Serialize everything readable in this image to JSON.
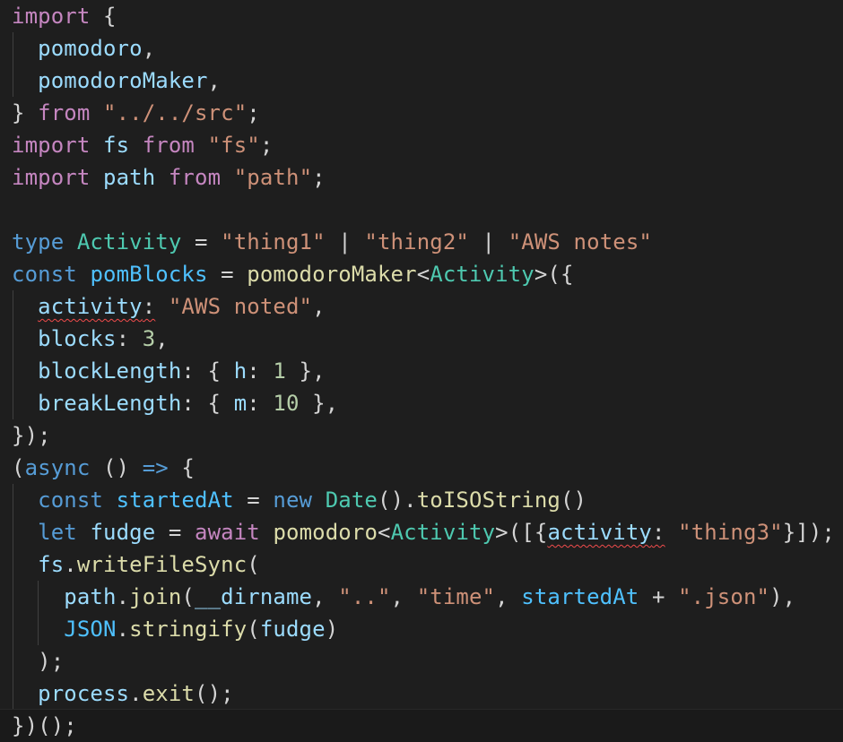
{
  "editor": {
    "lines": [
      [
        {
          "t": "import",
          "c": "kw"
        },
        {
          "t": " {",
          "c": "pun"
        }
      ],
      [
        {
          "t": "  "
        },
        {
          "t": "pomodoro",
          "c": "var"
        },
        {
          "t": ",",
          "c": "pun"
        }
      ],
      [
        {
          "t": "  "
        },
        {
          "t": "pomodoroMaker",
          "c": "var"
        },
        {
          "t": ",",
          "c": "pun"
        }
      ],
      [
        {
          "t": "} ",
          "c": "pun"
        },
        {
          "t": "from",
          "c": "kw"
        },
        {
          "t": " "
        },
        {
          "t": "\"../../src\"",
          "c": "str"
        },
        {
          "t": ";",
          "c": "pun"
        }
      ],
      [
        {
          "t": "import",
          "c": "kw"
        },
        {
          "t": " "
        },
        {
          "t": "fs",
          "c": "var"
        },
        {
          "t": " "
        },
        {
          "t": "from",
          "c": "kw"
        },
        {
          "t": " "
        },
        {
          "t": "\"fs\"",
          "c": "str"
        },
        {
          "t": ";",
          "c": "pun"
        }
      ],
      [
        {
          "t": "import",
          "c": "kw"
        },
        {
          "t": " "
        },
        {
          "t": "path",
          "c": "var"
        },
        {
          "t": " "
        },
        {
          "t": "from",
          "c": "kw"
        },
        {
          "t": " "
        },
        {
          "t": "\"path\"",
          "c": "str"
        },
        {
          "t": ";",
          "c": "pun"
        }
      ],
      [],
      [
        {
          "t": "type",
          "c": "kb"
        },
        {
          "t": " "
        },
        {
          "t": "Activity",
          "c": "type"
        },
        {
          "t": " = ",
          "c": "pun"
        },
        {
          "t": "\"thing1\"",
          "c": "str"
        },
        {
          "t": " | ",
          "c": "pun"
        },
        {
          "t": "\"thing2\"",
          "c": "str"
        },
        {
          "t": " | ",
          "c": "pun"
        },
        {
          "t": "\"AWS notes\"",
          "c": "str"
        }
      ],
      [
        {
          "t": "const",
          "c": "kb"
        },
        {
          "t": " "
        },
        {
          "t": "pomBlocks",
          "c": "const"
        },
        {
          "t": " = ",
          "c": "pun"
        },
        {
          "t": "pomodoroMaker",
          "c": "fn"
        },
        {
          "t": "<",
          "c": "pun"
        },
        {
          "t": "Activity",
          "c": "type"
        },
        {
          "t": ">({",
          "c": "pun"
        }
      ],
      [
        {
          "t": "  "
        },
        {
          "t": "activity",
          "c": "var",
          "err": true
        },
        {
          "t": ":",
          "c": "pun",
          "err": true
        },
        {
          "t": " "
        },
        {
          "t": "\"AWS noted\"",
          "c": "str"
        },
        {
          "t": ",",
          "c": "pun"
        }
      ],
      [
        {
          "t": "  "
        },
        {
          "t": "blocks",
          "c": "var"
        },
        {
          "t": ": ",
          "c": "pun"
        },
        {
          "t": "3",
          "c": "num"
        },
        {
          "t": ",",
          "c": "pun"
        }
      ],
      [
        {
          "t": "  "
        },
        {
          "t": "blockLength",
          "c": "var"
        },
        {
          "t": ": { ",
          "c": "pun"
        },
        {
          "t": "h",
          "c": "var"
        },
        {
          "t": ": ",
          "c": "pun"
        },
        {
          "t": "1",
          "c": "num"
        },
        {
          "t": " },",
          "c": "pun"
        }
      ],
      [
        {
          "t": "  "
        },
        {
          "t": "breakLength",
          "c": "var"
        },
        {
          "t": ": { ",
          "c": "pun"
        },
        {
          "t": "m",
          "c": "var"
        },
        {
          "t": ": ",
          "c": "pun"
        },
        {
          "t": "10",
          "c": "num"
        },
        {
          "t": " },",
          "c": "pun"
        }
      ],
      [
        {
          "t": "});",
          "c": "pun"
        }
      ],
      [
        {
          "t": "(",
          "c": "pun"
        },
        {
          "t": "async",
          "c": "kb"
        },
        {
          "t": " () ",
          "c": "pun"
        },
        {
          "t": "=>",
          "c": "kb"
        },
        {
          "t": " {",
          "c": "pun"
        }
      ],
      [
        {
          "t": "  "
        },
        {
          "t": "const",
          "c": "kb"
        },
        {
          "t": " "
        },
        {
          "t": "startedAt",
          "c": "const"
        },
        {
          "t": " = ",
          "c": "pun"
        },
        {
          "t": "new",
          "c": "kb"
        },
        {
          "t": " "
        },
        {
          "t": "Date",
          "c": "type"
        },
        {
          "t": "().",
          "c": "pun"
        },
        {
          "t": "toISOString",
          "c": "fn"
        },
        {
          "t": "()",
          "c": "pun"
        }
      ],
      [
        {
          "t": "  "
        },
        {
          "t": "let",
          "c": "kb"
        },
        {
          "t": " "
        },
        {
          "t": "fudge",
          "c": "var"
        },
        {
          "t": " = ",
          "c": "pun"
        },
        {
          "t": "await",
          "c": "kw"
        },
        {
          "t": " "
        },
        {
          "t": "pomodoro",
          "c": "fn"
        },
        {
          "t": "<",
          "c": "pun"
        },
        {
          "t": "Activity",
          "c": "type"
        },
        {
          "t": ">([{",
          "c": "pun"
        },
        {
          "t": "activity",
          "c": "var",
          "err": true
        },
        {
          "t": ":",
          "c": "pun",
          "err": true
        },
        {
          "t": " "
        },
        {
          "t": "\"thing3\"",
          "c": "str"
        },
        {
          "t": "}]);",
          "c": "pun"
        }
      ],
      [
        {
          "t": "  "
        },
        {
          "t": "fs",
          "c": "var"
        },
        {
          "t": ".",
          "c": "pun"
        },
        {
          "t": "writeFileSync",
          "c": "fn"
        },
        {
          "t": "(",
          "c": "pun"
        }
      ],
      [
        {
          "t": "    "
        },
        {
          "t": "path",
          "c": "var"
        },
        {
          "t": ".",
          "c": "pun"
        },
        {
          "t": "join",
          "c": "fn"
        },
        {
          "t": "(",
          "c": "pun"
        },
        {
          "t": "__dirname",
          "c": "var"
        },
        {
          "t": ", ",
          "c": "pun"
        },
        {
          "t": "\"..\"",
          "c": "str"
        },
        {
          "t": ", ",
          "c": "pun"
        },
        {
          "t": "\"time\"",
          "c": "str"
        },
        {
          "t": ", ",
          "c": "pun"
        },
        {
          "t": "startedAt",
          "c": "const"
        },
        {
          "t": " + ",
          "c": "pun"
        },
        {
          "t": "\".json\"",
          "c": "str"
        },
        {
          "t": "),",
          "c": "pun"
        }
      ],
      [
        {
          "t": "    "
        },
        {
          "t": "JSON",
          "c": "const"
        },
        {
          "t": ".",
          "c": "pun"
        },
        {
          "t": "stringify",
          "c": "fn"
        },
        {
          "t": "(",
          "c": "pun"
        },
        {
          "t": "fudge",
          "c": "var"
        },
        {
          "t": ")",
          "c": "pun"
        }
      ],
      [
        {
          "t": "  );",
          "c": "pun"
        }
      ],
      [
        {
          "t": "  "
        },
        {
          "t": "process",
          "c": "var"
        },
        {
          "t": ".",
          "c": "pun"
        },
        {
          "t": "exit",
          "c": "fn"
        },
        {
          "t": "();",
          "c": "pun"
        }
      ],
      [
        {
          "t": "})();",
          "c": "pun"
        }
      ]
    ]
  },
  "colors": {
    "background": "#1e1e1e",
    "keyword_control": "#c586c0",
    "keyword_storage": "#569cd6",
    "variable": "#9cdcfe",
    "constant": "#4fc1ff",
    "function": "#dcdcaa",
    "type": "#4ec9b0",
    "string": "#ce9178",
    "number": "#b5cea8",
    "punctuation": "#d4d4d4",
    "error_squiggle": "#f14c4c"
  }
}
